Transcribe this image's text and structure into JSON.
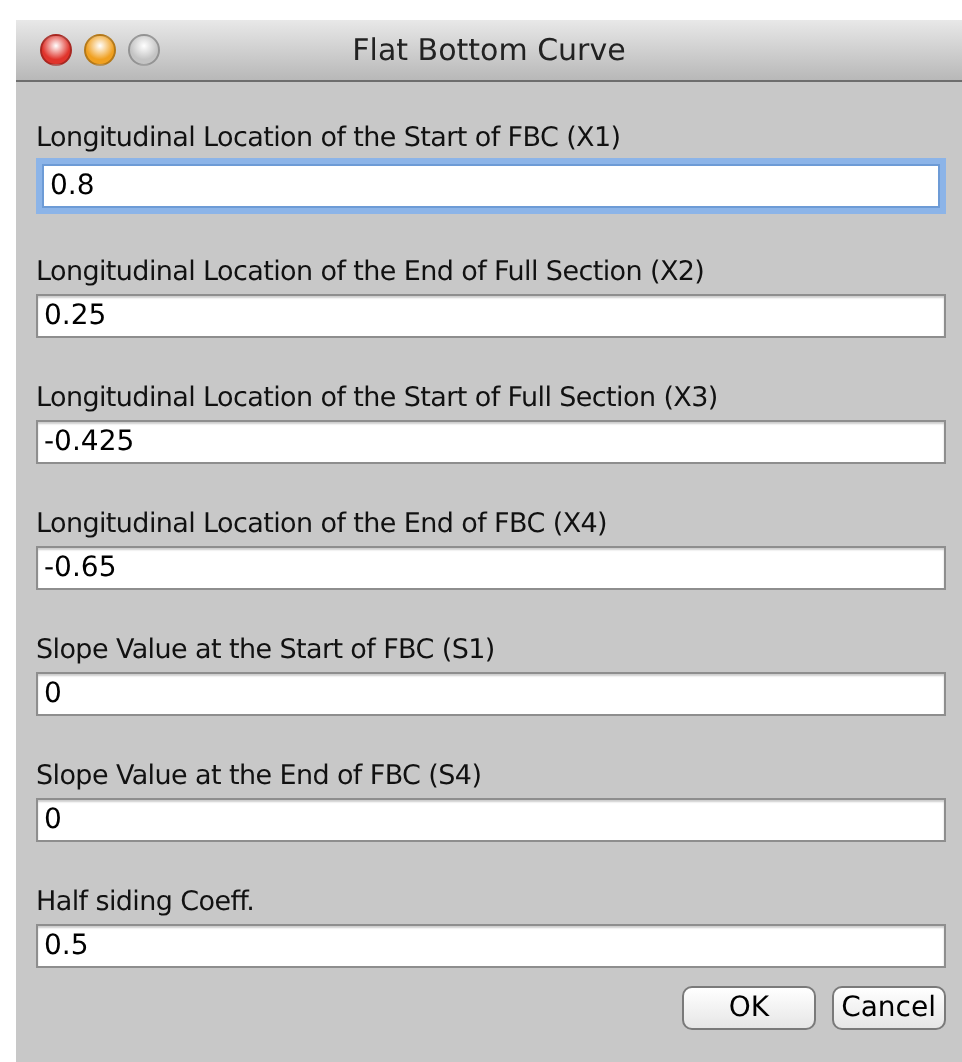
{
  "window": {
    "title": "Flat Bottom Curve"
  },
  "fields": [
    {
      "label": "Longitudinal Location of the Start of FBC (X1)",
      "value": "0.8",
      "focused": true
    },
    {
      "label": "Longitudinal Location of the End of Full Section (X2)",
      "value": "0.25",
      "focused": false
    },
    {
      "label": "Longitudinal Location of the Start of Full Section (X3)",
      "value": "-0.425",
      "focused": false
    },
    {
      "label": "Longitudinal Location of the End of FBC (X4)",
      "value": "-0.65",
      "focused": false
    },
    {
      "label": "Slope Value at the Start of FBC (S1)",
      "value": "0",
      "focused": false
    },
    {
      "label": "Slope Value at the End of FBC (S4)",
      "value": "0",
      "focused": false
    },
    {
      "label": "Half siding Coeff.",
      "value": "0.5",
      "focused": false
    }
  ],
  "buttons": [
    {
      "label": "OK",
      "kind": "default"
    },
    {
      "label": "Cancel",
      "kind": "plain"
    }
  ]
}
